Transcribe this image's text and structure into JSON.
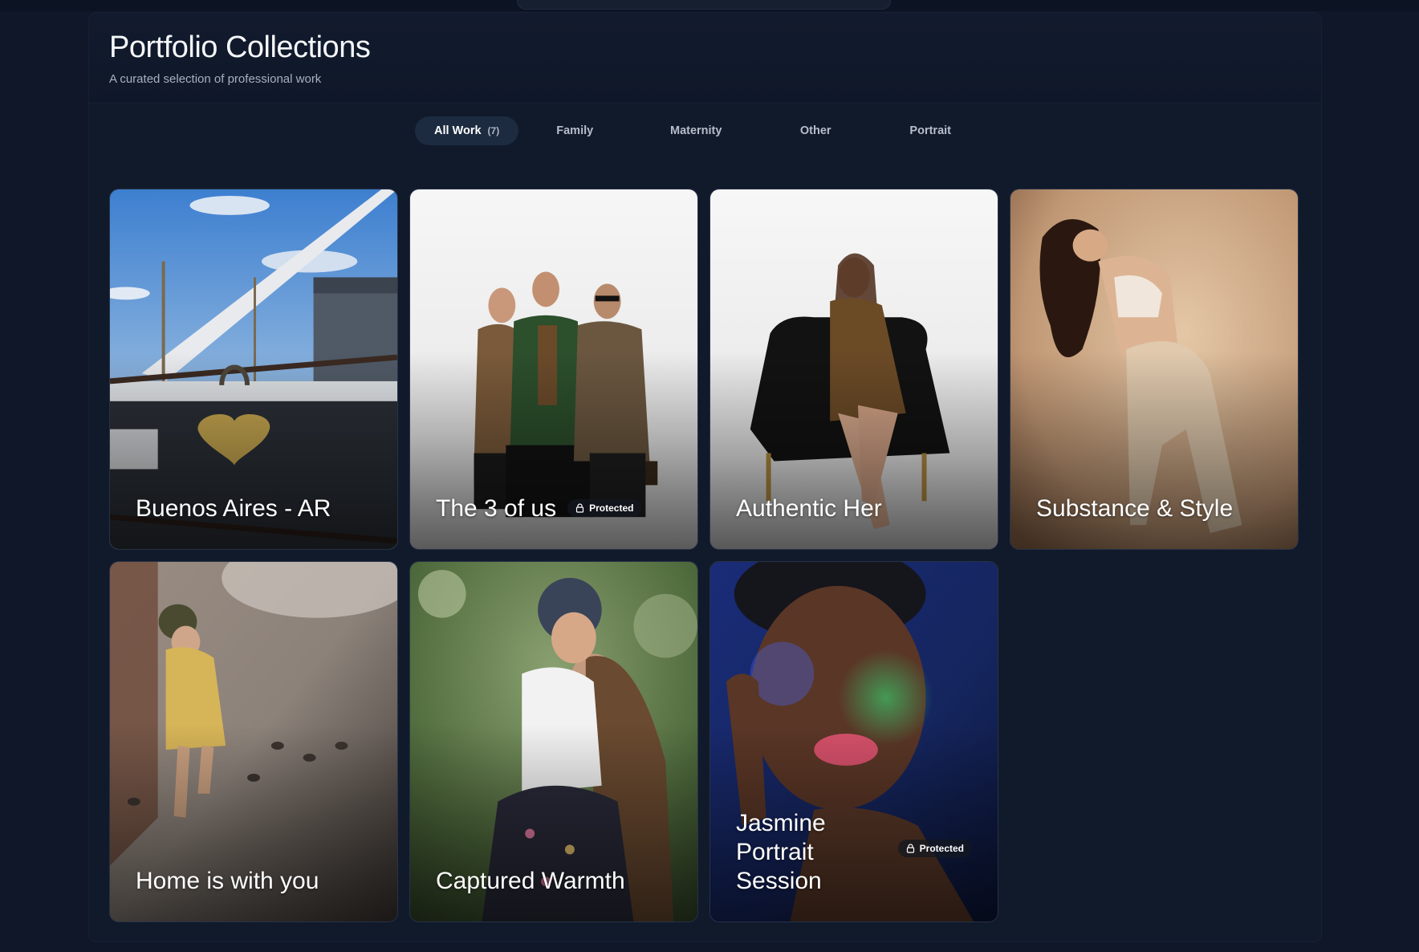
{
  "header": {
    "title": "Portfolio Collections",
    "subtitle": "A curated selection of professional work"
  },
  "tabs": [
    {
      "label": "All Work",
      "count": "(7)",
      "active": true
    },
    {
      "label": "Family"
    },
    {
      "label": "Maternity"
    },
    {
      "label": "Other"
    },
    {
      "label": "Portrait"
    }
  ],
  "collections": [
    {
      "title": "Buenos Aires - AR",
      "protected": false
    },
    {
      "title": "The 3 of us",
      "protected": true
    },
    {
      "title": "Authentic Her",
      "protected": false
    },
    {
      "title": "Substance & Style",
      "protected": false
    },
    {
      "title": "Home is with you",
      "protected": false
    },
    {
      "title": "Captured Warmth",
      "protected": false
    },
    {
      "title": "Jasmine Portrait Session",
      "protected": true
    }
  ],
  "badge_label": "Protected",
  "icons": {
    "lock": "lock-icon"
  },
  "colors": {
    "background": "#0f1729",
    "panel": "#111a2b",
    "active_tab": "#1d2b40"
  }
}
